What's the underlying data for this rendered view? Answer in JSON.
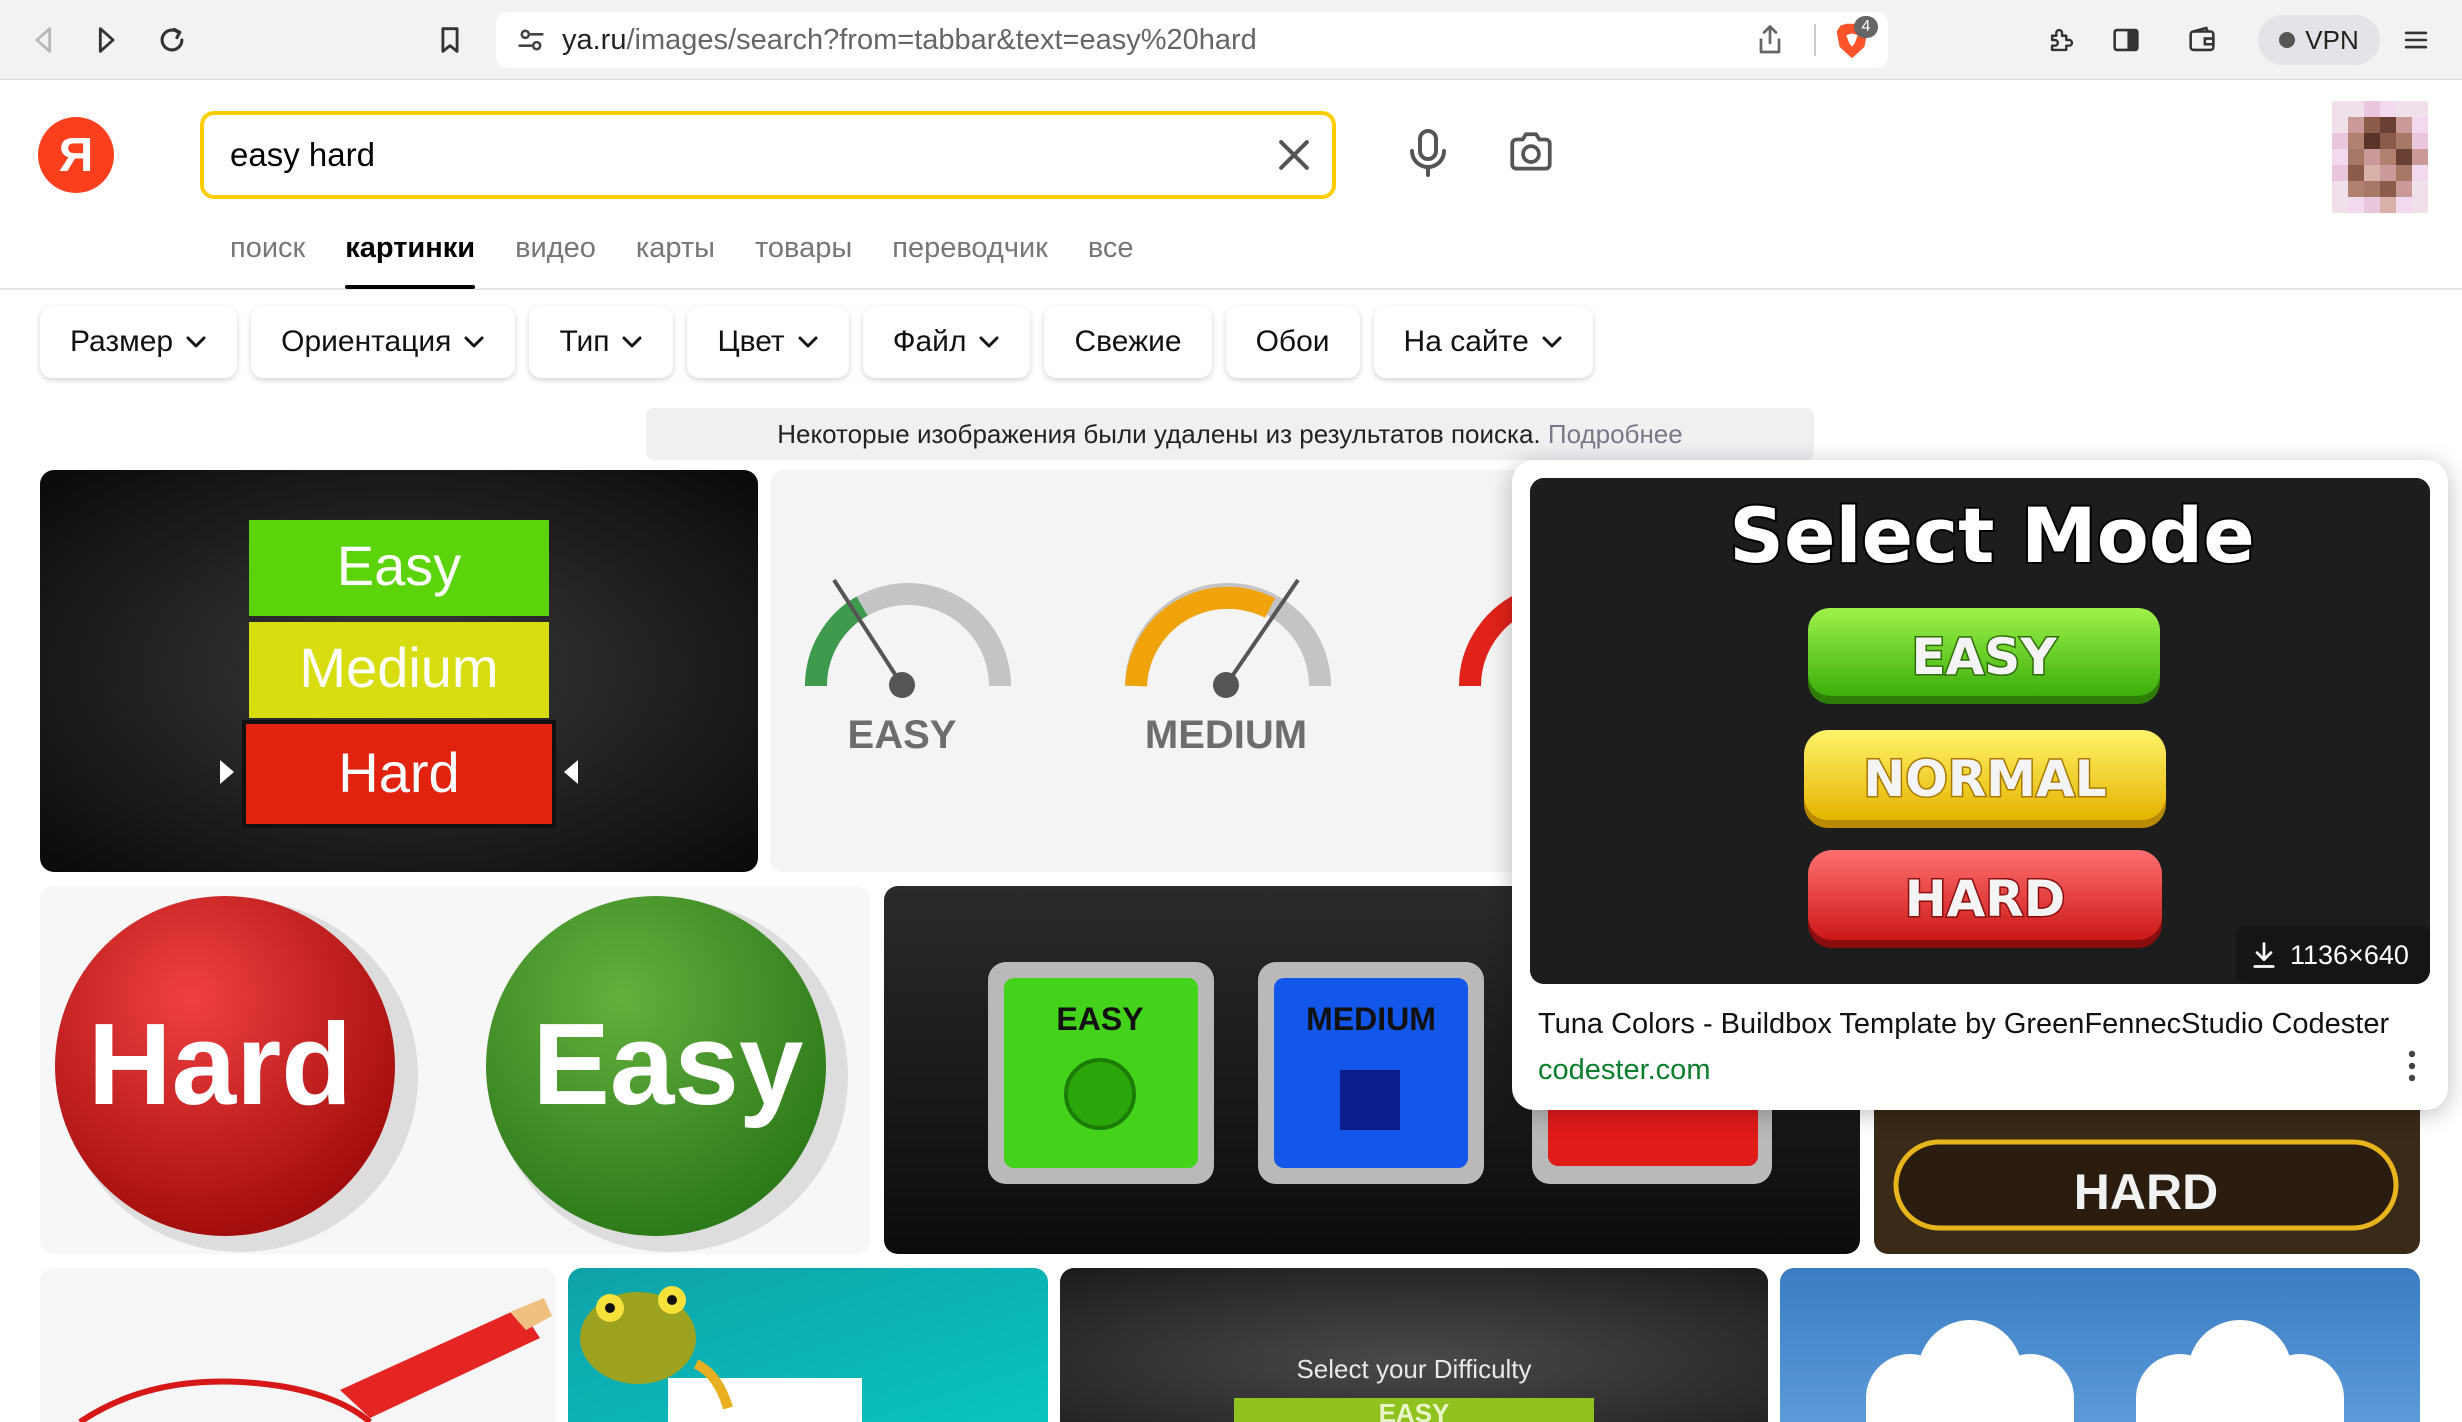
{
  "browser": {
    "url_domain": "ya.ru",
    "url_path": "/images/search?from=tabbar&text=easy%20hard",
    "shields_count": "4",
    "vpn_label": "VPN"
  },
  "search": {
    "logo": "Я",
    "query": "easy hard"
  },
  "tabs": [
    {
      "label": "поиск",
      "active": false
    },
    {
      "label": "картинки",
      "active": true
    },
    {
      "label": "видео",
      "active": false
    },
    {
      "label": "карты",
      "active": false
    },
    {
      "label": "товары",
      "active": false
    },
    {
      "label": "переводчик",
      "active": false
    },
    {
      "label": "все",
      "active": false
    }
  ],
  "filters": [
    {
      "label": "Размер",
      "dropdown": true
    },
    {
      "label": "Ориентация",
      "dropdown": true
    },
    {
      "label": "Тип",
      "dropdown": true
    },
    {
      "label": "Цвет",
      "dropdown": true
    },
    {
      "label": "Файл",
      "dropdown": true
    },
    {
      "label": "Свежие",
      "dropdown": false
    },
    {
      "label": "Обои",
      "dropdown": false
    },
    {
      "label": "На сайте",
      "dropdown": true
    }
  ],
  "notice": {
    "text": "Некоторые изображения были удалены из результатов поиска.",
    "link": "Подробнее"
  },
  "tiles": {
    "t1": {
      "easy": "Easy",
      "medium": "Medium",
      "hard": "Hard"
    },
    "t2": {
      "easy": "EASY",
      "medium": "MEDIUM"
    },
    "t3": {
      "hard": "Hard",
      "easy": "Easy"
    },
    "t4": {
      "easy": "EASY",
      "medium": "MEDIUM"
    },
    "t5": {
      "hard": "HARD"
    },
    "t8": {
      "caption": "Select your Difficulty",
      "easy": "EASY"
    }
  },
  "popup": {
    "image": {
      "title": "Select Mode",
      "easy": "EASY",
      "normal": "NORMAL",
      "hard": "HARD"
    },
    "size": "1136×640",
    "title": "Tuna Colors - Buildbox Template by GreenFennecStudio Codester",
    "site": "codester.com"
  },
  "colors": {
    "yandex_red": "#fc3f1d",
    "search_border": "#ffcc00",
    "site_green": "#0a7e2c"
  }
}
